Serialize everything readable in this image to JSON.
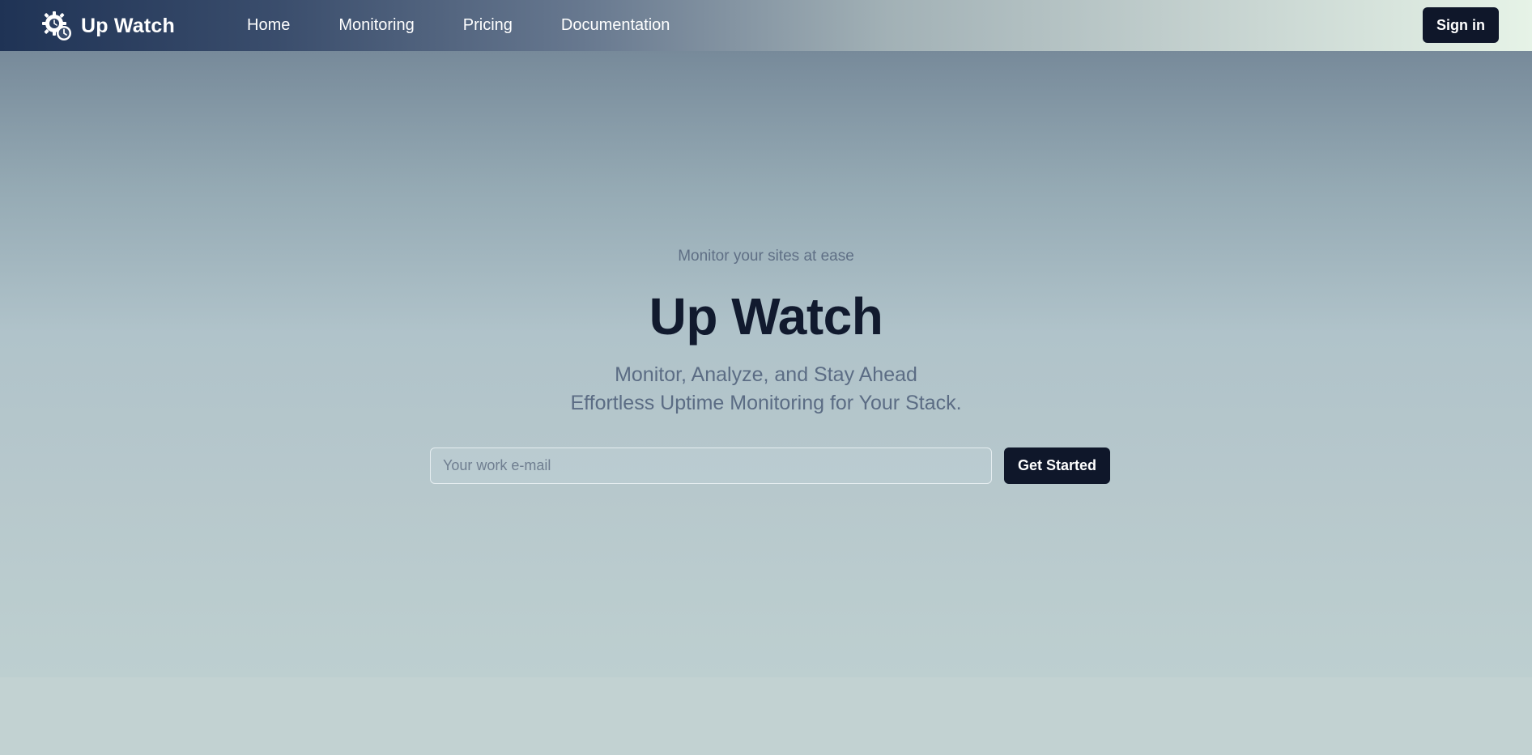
{
  "app": {
    "name": "Up Watch",
    "icon": "gear-clock-icon"
  },
  "nav": {
    "items": [
      {
        "label": "Home"
      },
      {
        "label": "Monitoring"
      },
      {
        "label": "Pricing"
      },
      {
        "label": "Documentation"
      }
    ],
    "signin_label": "Sign in"
  },
  "hero": {
    "eyebrow": "Monitor your sites at ease",
    "title": "Up Watch",
    "subtitle_line1": "Monitor, Analyze, and Stay Ahead",
    "subtitle_line2": "Effortless Uptime Monitoring for Your Stack."
  },
  "signup": {
    "email_placeholder": "Your work e-mail",
    "email_value": "",
    "cta_label": "Get Started"
  },
  "colors": {
    "primary_dark": "#0f172a",
    "title": "#111a2e",
    "muted_text": "#5b6c84"
  }
}
